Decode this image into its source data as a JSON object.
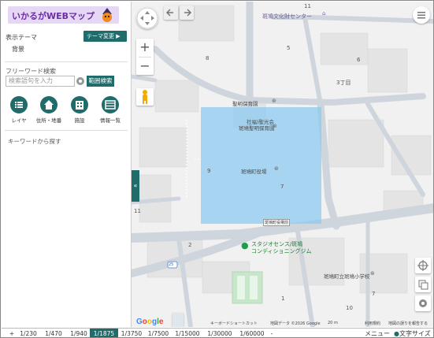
{
  "app": {
    "title": "いかるがWEBマップ"
  },
  "sidebar": {
    "theme_label": "表示テーマ",
    "theme_change_button": "テーマ変更 ▶",
    "theme_value": "背景",
    "freeword_label": "フリーワード検索",
    "search_placeholder": "検索語句を入力",
    "range_search_button": "範囲検索",
    "tools": [
      {
        "label": "レイヤ",
        "icon": "list-icon"
      },
      {
        "label": "住所・地番",
        "icon": "house-icon"
      },
      {
        "label": "施設",
        "icon": "building-icon"
      },
      {
        "label": "情報一覧",
        "icon": "table-icon"
      }
    ],
    "keyword_label": "キーワードから探す",
    "collapse_glyph": "«"
  },
  "map": {
    "labels": {
      "culture_center": "斑鳩文化財センター",
      "nursery": "聖明保育園",
      "social_welfare": "社福)聖光会",
      "nursery_sub": "斑鳩聖明保育園",
      "town_office": "斑鳩町役場",
      "town_office_sign": "斑鳩町役場前",
      "stadium": "スタジオセンス/斑鳩",
      "stadium_sub": "コンディショニングジム",
      "school": "斑鳩町立斑鳩小学校",
      "chome3": "3丁目",
      "num_11_top": "11",
      "num_8": "8",
      "num_5": "5",
      "num_6": "6",
      "num_7": "7",
      "num_9": "9",
      "num_11_left": "11",
      "num_2": "2",
      "num_1": "1",
      "num_10": "10",
      "num_7b": "7",
      "num_25": "25"
    },
    "zoom_in": "+",
    "zoom_out": "−",
    "google": "Google",
    "attribution": "地図データ ©2026 Google",
    "attribution_scale": "20 m",
    "attribution_terms": "利用規約",
    "attribution_report": "地図の誤りを報告する",
    "keyboard_shortcut": "キーボードショートカット"
  },
  "scalebar": {
    "plus": "+",
    "scales": [
      "1/230",
      "1/470",
      "1/940",
      "1/1875",
      "1/3750",
      "1/7500",
      "1/15000",
      "1/30000",
      "1/60000"
    ],
    "active_scale": "1/1875",
    "minus": "-",
    "menu": "メニュー",
    "text_size": "文字サイズ"
  },
  "colors": {
    "accent": "#1f6c6b",
    "highlight_area": "#8ec9ef",
    "title_bg": "#e6d7f5"
  }
}
